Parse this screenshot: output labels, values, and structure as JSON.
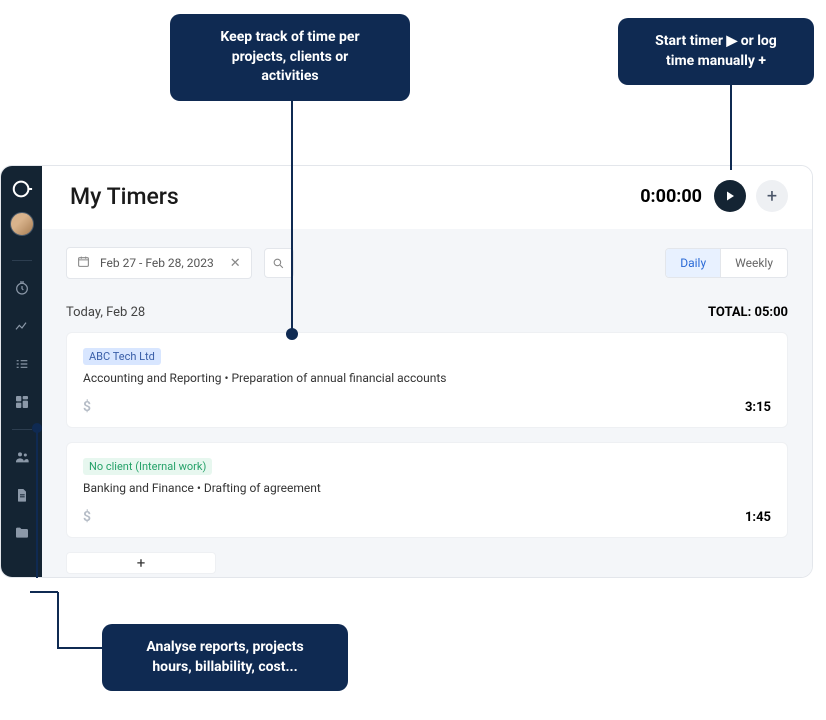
{
  "callouts": {
    "track": "Keep track of time per\nprojects, clients or\nactivities",
    "timer": "Start timer ▶ or log\ntime manually  +",
    "reports": "Analyse reports, projects\nhours,  billability, cost..."
  },
  "header": {
    "title": "My Timers",
    "timer_value": "0:00:00"
  },
  "toolbar": {
    "date_range": "Feb 27 - Feb 28, 2023",
    "view_daily": "Daily",
    "view_weekly": "Weekly"
  },
  "day": {
    "label": "Today, Feb 28",
    "total_label": "TOTAL: 05:00"
  },
  "entries": [
    {
      "client": "ABC Tech Ltd",
      "tag_class": "tag-blue",
      "desc": "Accounting and Reporting • Preparation of annual financial accounts",
      "billable": "$",
      "duration": "3:15"
    },
    {
      "client": "No client (Internal work)",
      "tag_class": "tag-teal",
      "desc": "Banking and Finance • Drafting of agreement",
      "billable": "$",
      "duration": "1:45"
    }
  ],
  "add_row_glyph": "+"
}
